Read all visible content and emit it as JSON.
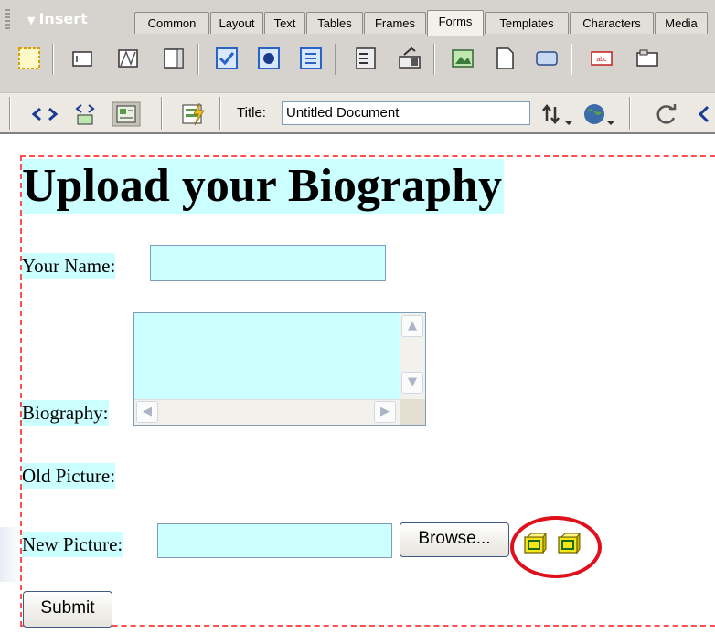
{
  "insert_panel": {
    "title": "Insert",
    "tabs": [
      "Common",
      "Layout",
      "Text",
      "Tables",
      "Frames",
      "Forms",
      "Templates",
      "Characters",
      "Media"
    ],
    "active_tab": "Forms",
    "tools": [
      {
        "name": "form-icon"
      },
      {
        "name": "text-field-icon"
      },
      {
        "name": "hidden-field-icon"
      },
      {
        "name": "textarea-icon"
      },
      {
        "name": "checkbox-icon"
      },
      {
        "name": "radio-button-icon"
      },
      {
        "name": "radio-group-icon"
      },
      {
        "name": "list-menu-icon"
      },
      {
        "name": "jump-menu-icon"
      },
      {
        "name": "image-field-icon"
      },
      {
        "name": "file-field-icon"
      },
      {
        "name": "button-icon"
      },
      {
        "name": "label-icon"
      },
      {
        "name": "fieldset-icon"
      }
    ]
  },
  "document_toolbar": {
    "title_label": "Title:",
    "title_value": "Untitled Document"
  },
  "page": {
    "heading": "Upload your Biography",
    "name_label": "Your Name:",
    "bio_label": "Biography:",
    "old_picture_label": "Old Picture:",
    "new_picture_label": "New Picture:",
    "browse_label": "Browse...",
    "submit_label": "Submit"
  },
  "colors": {
    "highlight": "#ccffff",
    "form_border": "#ff5050",
    "annotation_circle": "#e0101a",
    "toolbar_bg": "#d6d3ce"
  }
}
